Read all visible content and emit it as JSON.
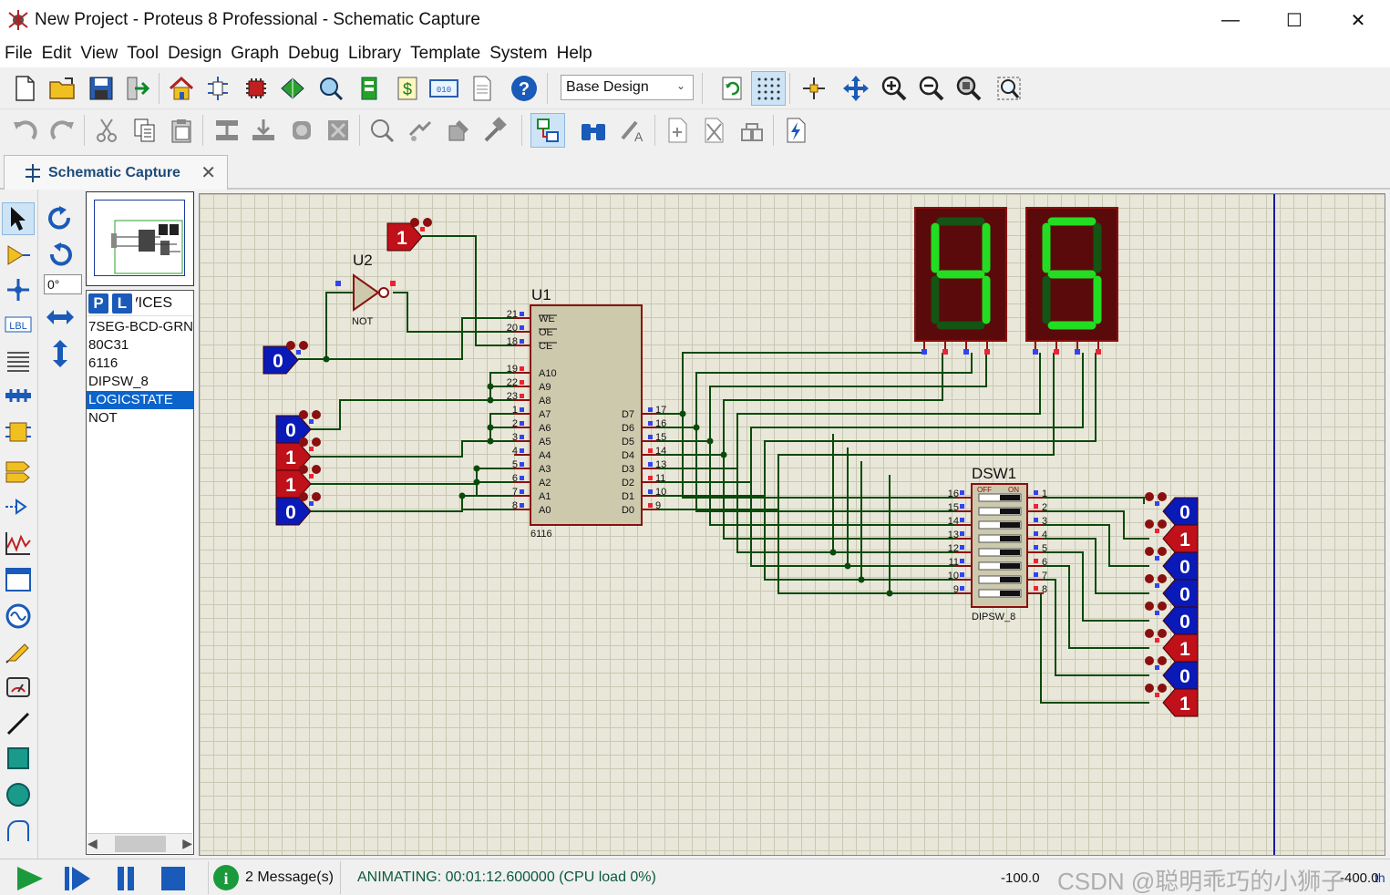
{
  "window": {
    "title": "New Project - Proteus 8 Professional - Schematic Capture",
    "minimize_glyph": "—",
    "maximize_glyph": "☐",
    "close_glyph": "✕"
  },
  "menu": [
    "File",
    "Edit",
    "View",
    "Tool",
    "Design",
    "Graph",
    "Debug",
    "Library",
    "Template",
    "System",
    "Help"
  ],
  "toolbar": {
    "design_select_value": "Base Design",
    "icons_row1": [
      "new-file",
      "open-folder",
      "save",
      "import",
      "home",
      "schematic-capture",
      "pcb-layout",
      "3d-viewer",
      "gerber-viewer",
      "bill-of-materials",
      "design-explorer",
      "source-code",
      "notes",
      "help",
      "refresh",
      "grid",
      "origin",
      "pan",
      "zoom-in",
      "zoom-out",
      "zoom-all",
      "zoom-area"
    ],
    "icons_row2": [
      "undo",
      "redo",
      "cut",
      "copy",
      "paste",
      "block-copy",
      "block-move",
      "block-rotate",
      "block-delete",
      "pick-parts",
      "make-device",
      "packaging-tool",
      "decompose",
      "wire-autorouter",
      "search-tag",
      "property-assignment",
      "new-sheet",
      "remove-sheet",
      "exit-to-parent",
      "electrical-rule-check"
    ]
  },
  "tab": {
    "label": "Schematic Capture",
    "close": "✕"
  },
  "left_tools": [
    "selection",
    "component",
    "junction-dot",
    "wire-label",
    "text-script",
    "buses",
    "subcircuit",
    "terminals",
    "device-pins",
    "graph",
    "active-popup",
    "generator",
    "probe",
    "virtual-instruments",
    "line-2d",
    "box-2d",
    "circle-2d",
    "arc-2d"
  ],
  "rotation": {
    "angle": "0°"
  },
  "devices": {
    "pick_label": "P",
    "library_label": "L",
    "title": "DEVICES",
    "items": [
      "7SEG-BCD-GRN",
      "80C31",
      "6116",
      "DIPSW_8",
      "LOGICSTATE",
      "NOT"
    ],
    "selected": "LOGICSTATE"
  },
  "schematic": {
    "u2": {
      "ref": "U2",
      "type": "NOT"
    },
    "u1": {
      "ref": "U1",
      "type": "6116",
      "left_pin_numbers": [
        "21",
        "20",
        "18",
        "19",
        "22",
        "23",
        "1",
        "2",
        "3",
        "4",
        "5",
        "6",
        "7",
        "8"
      ],
      "left_pin_names": [
        "WE",
        "OE",
        "CE",
        "A10",
        "A9",
        "A8",
        "A7",
        "A6",
        "A5",
        "A4",
        "A3",
        "A2",
        "A1",
        "A0"
      ],
      "right_pin_numbers": [
        "17",
        "16",
        "15",
        "14",
        "13",
        "11",
        "10",
        "9"
      ],
      "right_pin_names": [
        "D7",
        "D6",
        "D5",
        "D4",
        "D3",
        "D2",
        "D1",
        "D0"
      ]
    },
    "dsw1": {
      "ref": "DSW1",
      "type": "DIPSW_8",
      "off_label": "OFF",
      "on_label": "ON",
      "left_pins": [
        "16",
        "15",
        "14",
        "13",
        "12",
        "11",
        "10",
        "9"
      ],
      "right_pins": [
        "1",
        "2",
        "3",
        "4",
        "5",
        "6",
        "7",
        "8"
      ]
    },
    "seven_seg_digits": [
      "4",
      "5"
    ],
    "logic_state_top": "1",
    "logic_state_ctrl": "0",
    "logic_states_addr": [
      "0",
      "1",
      "1",
      "0"
    ],
    "logic_states_switch": [
      "0",
      "1",
      "0",
      "0",
      "0",
      "1",
      "0",
      "1"
    ],
    "colors": {
      "wire": "#0a4a0a",
      "high": "#c0101a",
      "low": "#0a1ab8",
      "segment_on": "#22dd22",
      "segment_off": "#145414",
      "chip_body": "#ccc9ad"
    }
  },
  "status": {
    "messages": "2 Message(s)",
    "animation": "ANIMATING: 00:01:12.600000 (CPU load 0%)",
    "coord_x": "-100.0",
    "coord_y": "-400.0",
    "unit": "th",
    "watermark": "CSDN @聪明乖巧的小狮子"
  }
}
